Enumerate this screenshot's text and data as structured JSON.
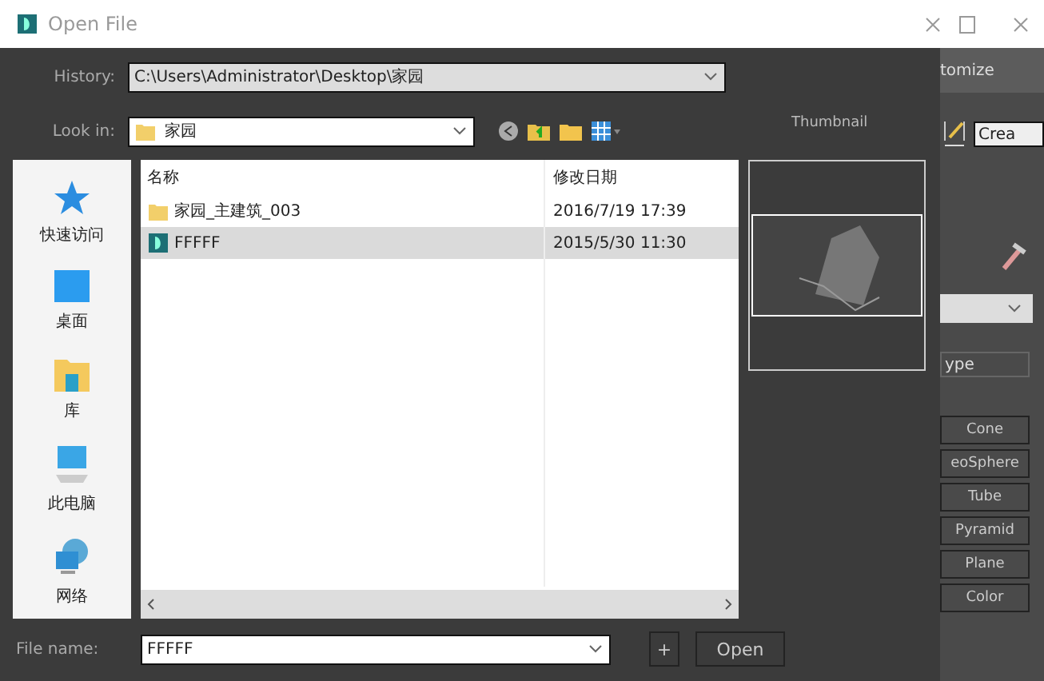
{
  "window": {
    "title": "Open File"
  },
  "history": {
    "label": "History:",
    "value": "C:\\Users\\Administrator\\Desktop\\家园"
  },
  "look_in": {
    "label": "Look in:",
    "value": "家园"
  },
  "thumbnail": {
    "label": "Thumbnail"
  },
  "places": [
    {
      "label": "快速访问",
      "kind": "star"
    },
    {
      "label": "桌面",
      "kind": "desktop"
    },
    {
      "label": "库",
      "kind": "library"
    },
    {
      "label": "此电脑",
      "kind": "computer"
    },
    {
      "label": "网络",
      "kind": "network"
    }
  ],
  "file_list": {
    "columns": [
      "名称",
      "修改日期"
    ],
    "rows": [
      {
        "kind": "folder",
        "name": "家园_主建筑_003",
        "modified": "2016/7/19 17:39",
        "selected": false
      },
      {
        "kind": "scene",
        "name": "FFFFF",
        "modified": "2015/5/30 11:30",
        "selected": true
      }
    ]
  },
  "file_name": {
    "label": "File name:",
    "value": "FFFFF"
  },
  "buttons": {
    "add": "+",
    "open": "Open"
  },
  "background_app": {
    "menu_text": "tomize",
    "field": "Crea",
    "group_label": "ype",
    "buttons": [
      "Cone",
      "eoSphere",
      "Tube",
      "Pyramid",
      "Plane",
      "Color"
    ]
  }
}
